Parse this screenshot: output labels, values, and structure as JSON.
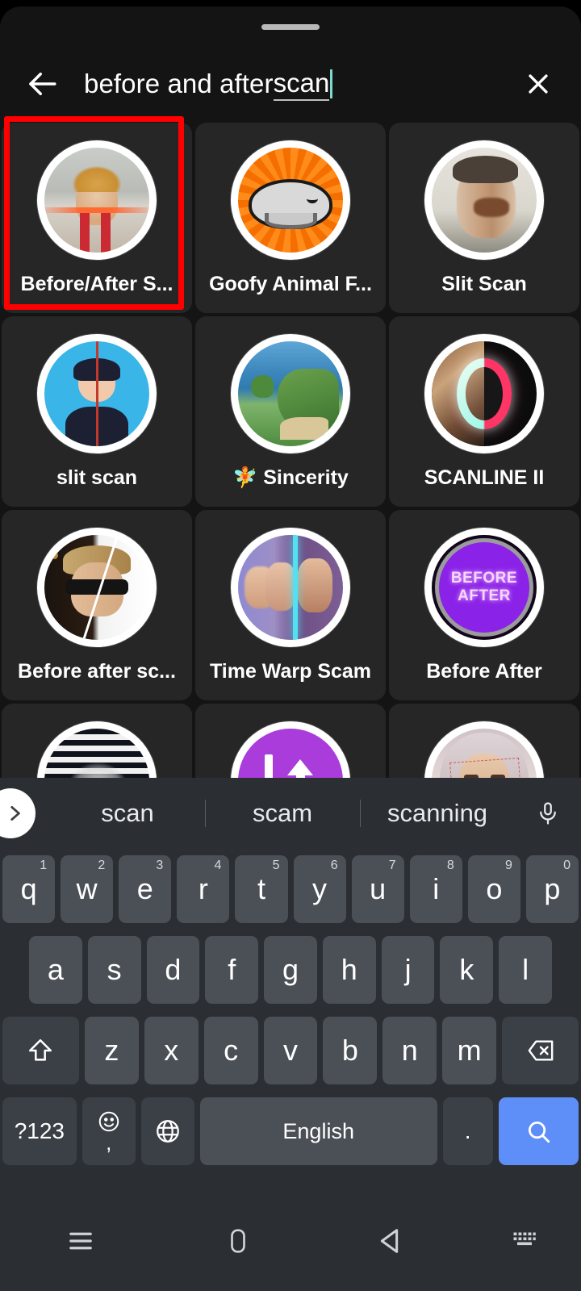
{
  "search": {
    "query_committed": "before and after ",
    "query_composing": "scan",
    "back_icon": "arrow-left-icon",
    "clear_icon": "close-icon"
  },
  "effects": [
    {
      "label": "Before/After S...",
      "thumb": "marilyn-clouds",
      "selected": true
    },
    {
      "label": "Goofy Animal F...",
      "thumb": "blobfish-orange",
      "selected": false
    },
    {
      "label": "Slit Scan",
      "thumb": "slit-scan-face",
      "selected": false
    },
    {
      "label": "slit scan",
      "thumb": "avatar-split-line",
      "selected": false
    },
    {
      "label": "🧚 Sincerity",
      "thumb": "tropical-island",
      "selected": false
    },
    {
      "label": "SCANLINE II",
      "thumb": "scanline-ring",
      "selected": false
    },
    {
      "label": "Before after sc...",
      "thumb": "sunglasses-split",
      "selected": false
    },
    {
      "label": "Time Warp Scam",
      "thumb": "time-warp-faces",
      "selected": false
    },
    {
      "label": "Before After",
      "thumb": "purple-before-after",
      "selected": false,
      "badge_line1": "BEFORE",
      "badge_line2": "AFTER"
    },
    {
      "label": "",
      "thumb": "butterfly-stripes",
      "selected": false
    },
    {
      "label": "",
      "thumb": "purple-arrows",
      "selected": false
    },
    {
      "label": "",
      "thumb": "hijab-face-box",
      "selected": false
    }
  ],
  "keyboard": {
    "suggestions": [
      "scan",
      "scam",
      "scanning"
    ],
    "expand_icon": "chevron-right-icon",
    "mic_icon": "microphone-icon",
    "row1": [
      {
        "key": "q",
        "num": "1"
      },
      {
        "key": "w",
        "num": "2"
      },
      {
        "key": "e",
        "num": "3"
      },
      {
        "key": "r",
        "num": "4"
      },
      {
        "key": "t",
        "num": "5"
      },
      {
        "key": "y",
        "num": "6"
      },
      {
        "key": "u",
        "num": "7"
      },
      {
        "key": "i",
        "num": "8"
      },
      {
        "key": "o",
        "num": "9"
      },
      {
        "key": "p",
        "num": "0"
      }
    ],
    "row2": [
      "a",
      "s",
      "d",
      "f",
      "g",
      "h",
      "j",
      "k",
      "l"
    ],
    "row3_letters": [
      "z",
      "x",
      "c",
      "v",
      "b",
      "n",
      "m"
    ],
    "shift_icon": "shift-arrow-up-icon",
    "backspace_icon": "backspace-icon",
    "symbols_label": "?123",
    "emoji_icon": "emoji-smiley-icon",
    "emoji_comma": ",",
    "globe_icon": "globe-language-icon",
    "space_label": "English",
    "period_label": ".",
    "enter_icon": "search-magnifier-icon"
  },
  "navbar": {
    "recents_icon": "recents-menu-icon",
    "home_icon": "home-icon",
    "back_icon": "back-triangle-icon",
    "keyboard_icon": "hide-keyboard-icon"
  },
  "colors": {
    "accent_blue": "#5e8ef7",
    "annotation_red": "#ff0000",
    "purple": "#8b22e8",
    "key_bg": "#4b5057",
    "keyboard_bg": "#2b2f33",
    "sheet_bg": "#141414",
    "cell_bg": "#262626",
    "caret_teal": "#7fd8cf"
  }
}
